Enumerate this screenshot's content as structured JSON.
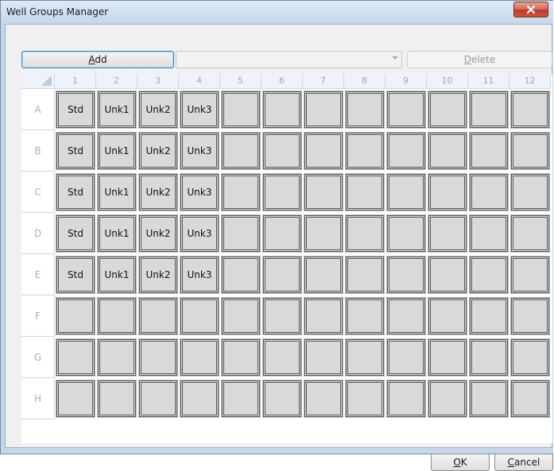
{
  "window": {
    "title": "Well Groups Manager",
    "close_glyph": "✕"
  },
  "toolbar": {
    "add_label": "Add",
    "add_mnemonic": "A",
    "group_select_value": "",
    "delete_label": "Delete",
    "delete_mnemonic": "D"
  },
  "plate": {
    "columns": [
      "1",
      "2",
      "3",
      "4",
      "5",
      "6",
      "7",
      "8",
      "9",
      "10",
      "11",
      "12"
    ],
    "rows": [
      "A",
      "B",
      "C",
      "D",
      "E",
      "F",
      "G",
      "H"
    ],
    "wells": [
      [
        "Std",
        "Unk1",
        "Unk2",
        "Unk3",
        "",
        "",
        "",
        "",
        "",
        "",
        "",
        ""
      ],
      [
        "Std",
        "Unk1",
        "Unk2",
        "Unk3",
        "",
        "",
        "",
        "",
        "",
        "",
        "",
        ""
      ],
      [
        "Std",
        "Unk1",
        "Unk2",
        "Unk3",
        "",
        "",
        "",
        "",
        "",
        "",
        "",
        ""
      ],
      [
        "Std",
        "Unk1",
        "Unk2",
        "Unk3",
        "",
        "",
        "",
        "",
        "",
        "",
        "",
        ""
      ],
      [
        "Std",
        "Unk1",
        "Unk2",
        "Unk3",
        "",
        "",
        "",
        "",
        "",
        "",
        "",
        ""
      ],
      [
        "",
        "",
        "",
        "",
        "",
        "",
        "",
        "",
        "",
        "",
        "",
        ""
      ],
      [
        "",
        "",
        "",
        "",
        "",
        "",
        "",
        "",
        "",
        "",
        "",
        ""
      ],
      [
        "",
        "",
        "",
        "",
        "",
        "",
        "",
        "",
        "",
        "",
        "",
        ""
      ]
    ]
  },
  "footer": {
    "ok_label": "OK",
    "ok_mnemonic": "O",
    "cancel_label": "Cancel",
    "cancel_mnemonic": "C"
  }
}
